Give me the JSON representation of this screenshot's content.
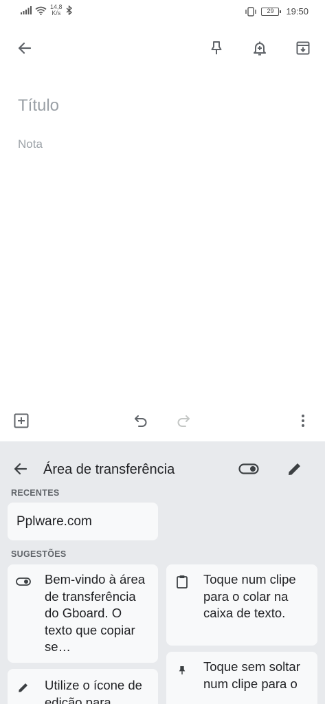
{
  "status_bar": {
    "net_speed_value": "14,8",
    "net_speed_unit": "K/s",
    "battery": "29",
    "time": "19:50"
  },
  "note": {
    "title_placeholder": "Título",
    "body_placeholder": "Nota"
  },
  "clipboard": {
    "title": "Área de transferência",
    "recent_label": "RECENTES",
    "recent_items": [
      "Pplware.com"
    ],
    "suggestions_label": "SUGESTÕES",
    "suggestions": [
      {
        "icon": "toggle-icon",
        "text": "Bem-vindo à área de transferência do Gboard. O texto que copiar se…"
      },
      {
        "icon": "clipboard-icon",
        "text": "Toque num clipe para o colar na caixa de texto."
      },
      {
        "icon": "pencil-icon",
        "text": "Utilize o ícone de edição para"
      },
      {
        "icon": "pin-icon",
        "text": "Toque sem soltar num clipe para o"
      }
    ]
  }
}
